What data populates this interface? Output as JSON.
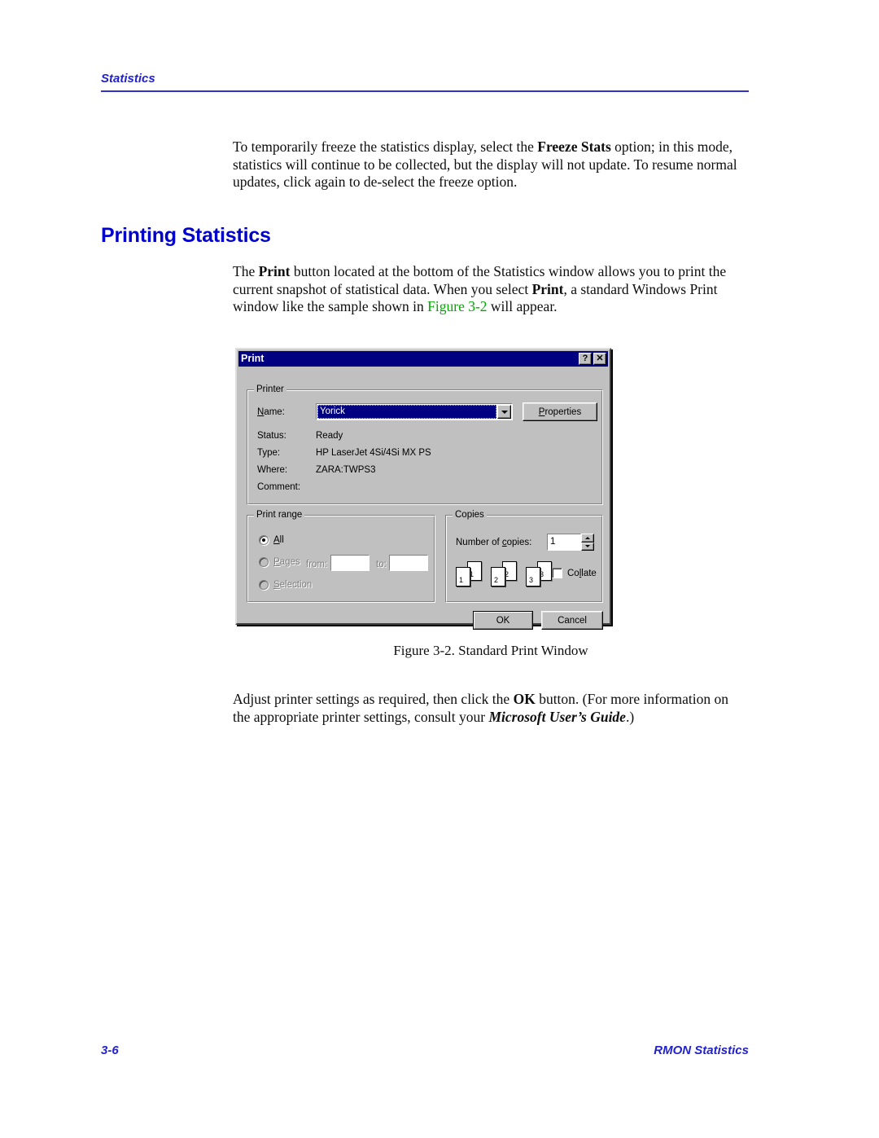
{
  "page": {
    "header_text": "Statistics",
    "heading": "Printing Statistics",
    "footer_left": "3-6",
    "footer_right": "RMON Statistics",
    "figure_caption": "Figure 3-2.  Standard Print Window"
  },
  "paragraphs": {
    "p1_a": "To temporarily freeze the statistics display, select the ",
    "p1_bold": "Freeze Stats",
    "p1_b": " option; in this mode, statistics will continue to be collected, but the display will not update. To resume normal updates, click again to de-select the freeze option.",
    "p2_a": "The ",
    "p2_bold1": "Print",
    "p2_b": " button located at the bottom of the Statistics window allows you to print the current snapshot of statistical data. When you select ",
    "p2_bold2": "Print",
    "p2_c": ", a standard Windows Print window like the sample shown in ",
    "p2_link": "Figure 3-2",
    "p2_d": " will appear.",
    "p3_a": "Adjust printer settings as required, then click the ",
    "p3_bold1": "OK",
    "p3_b": " button. (For more information on the appropriate printer settings, consult your ",
    "p3_bolditalic": "Microsoft User’s Guide",
    "p3_c": ".)"
  },
  "dialog": {
    "title": "Print",
    "help_button": "?",
    "close_button": "✕",
    "printer_group": {
      "legend": "Printer",
      "name_label": "Name:",
      "name_value": "Yorick",
      "properties_button": "Properties",
      "status_label": "Status:",
      "status_value": "Ready",
      "type_label": "Type:",
      "type_value": "HP LaserJet 4Si/4Si MX PS",
      "where_label": "Where:",
      "where_value": "ZARA:TWPS3",
      "comment_label": "Comment:",
      "comment_value": ""
    },
    "print_range_group": {
      "legend": "Print range",
      "all_label": "All",
      "pages_label": "Pages",
      "from_label": "from:",
      "from_value": "",
      "to_label": "to:",
      "to_value": "",
      "selection_label": "Selection",
      "selected": "All"
    },
    "copies_group": {
      "legend": "Copies",
      "number_label": "Number of copies:",
      "number_value": "1",
      "collate_label": "Collate",
      "collate_checked": false,
      "page_icons": [
        "1",
        "2",
        "3"
      ]
    },
    "ok_button": "OK",
    "cancel_button": "Cancel"
  },
  "colors": {
    "heading_blue": "#0000cc",
    "header_blue": "#2222cc",
    "link_green": "#00a800",
    "titlebar_navy": "#000080",
    "dialog_gray": "#c0c0c0"
  }
}
